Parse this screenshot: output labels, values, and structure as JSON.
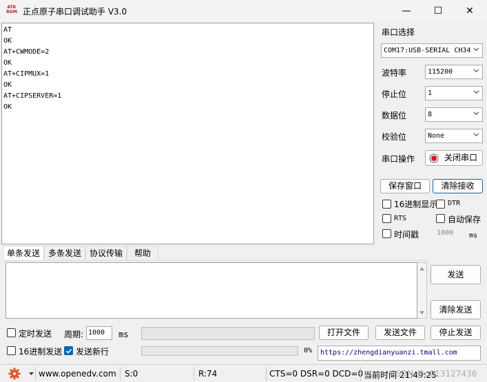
{
  "window": {
    "icon_text_top": "ATK",
    "icon_text_bottom": "ROM",
    "title": "正点原子串口调试助手 V3.0",
    "minimize": "—",
    "maximize": "☐",
    "close": "✕"
  },
  "receive": {
    "lines": [
      "AT",
      "OK",
      "AT+CWMODE=2",
      "OK",
      "AT+CIPMUX=1",
      "OK",
      "AT+CIPSERVER=1",
      "OK"
    ]
  },
  "serial_panel": {
    "port_select_label": "串口选择",
    "port_value": "COM17:USB-SERIAL CH34",
    "baud_label": "波特率",
    "baud_value": "115200",
    "stopbit_label": "停止位",
    "stopbit_value": "1",
    "databit_label": "数据位",
    "databit_value": "8",
    "parity_label": "校验位",
    "parity_value": "None",
    "port_op_label": "串口操作",
    "close_port_button": "关闭串口",
    "save_window_button": "保存窗口",
    "clear_receive_button": "清除接收",
    "hex_display": "16进制显示",
    "dtr": "DTR",
    "rts": "RTS",
    "auto_save": "自动保存",
    "timestamp": "时间戳",
    "timestamp_ms_value": "1000",
    "timestamp_ms_unit": "ms",
    "hex_display_checked": false,
    "dtr_checked": false,
    "rts_checked": false,
    "auto_save_checked": false,
    "timestamp_checked": false
  },
  "tabs": [
    "单条发送",
    "多条发送",
    "协议传输",
    "帮助"
  ],
  "send": {
    "send_button": "发送",
    "clear_send_button": "清除发送",
    "timed_send": "定时发送",
    "timed_send_checked": false,
    "period_label": "周期:",
    "period_value": "1000",
    "period_unit": "ms",
    "open_file_button": "打开文件",
    "send_file_button": "发送文件",
    "stop_send_button": "停止发送",
    "hex_send": "16进制发送",
    "hex_send_checked": false,
    "send_newline": "发送新行",
    "send_newline_checked": true,
    "progress_text": "0%",
    "progress_value": 0,
    "shop_link": "https://zhengdianyuanzi.tmall.com"
  },
  "status": {
    "website": "www.openedv.com",
    "sent": "S:0",
    "received": "R:74",
    "line_state": "CTS=0 DSR=0 DCD=0",
    "current_time": "当前时间 21:49:25",
    "watermark": "CSDN @u013127436"
  },
  "colors": {
    "accent": "#0067c0",
    "record_dot": "#e81123"
  }
}
